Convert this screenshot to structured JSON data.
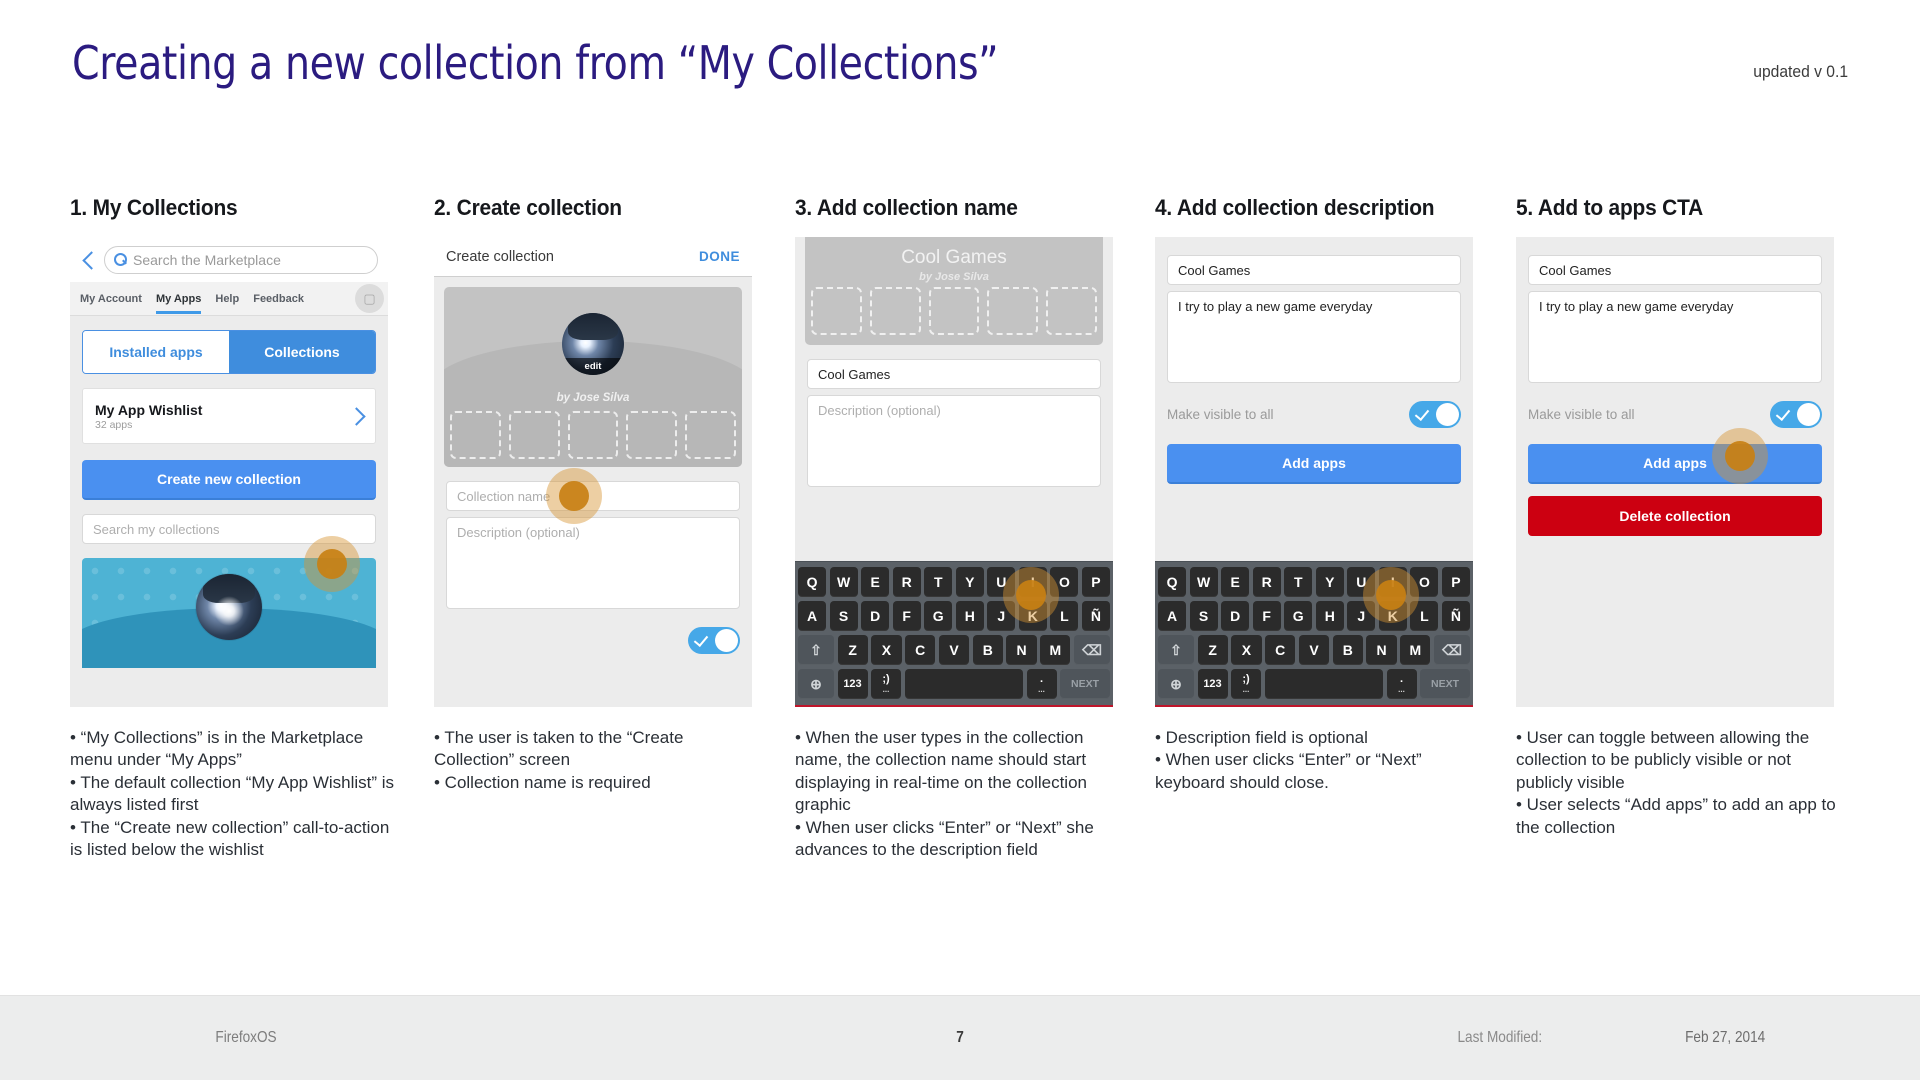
{
  "header": {
    "title": "Creating a new collection from “My Collections”",
    "version": "updated v 0.1"
  },
  "panels": [
    {
      "title": "1. My Collections",
      "search": {
        "placeholder": "Search the Marketplace"
      },
      "nav": [
        "My Account",
        "My Apps",
        "Help",
        "Feedback"
      ],
      "segmented": {
        "left": "Installed apps",
        "right": "Collections"
      },
      "wishlist": {
        "title": "My App Wishlist",
        "subtitle": "32 apps"
      },
      "cta": "Create new collection",
      "search_collections_placeholder": "Search my collections",
      "caption": [
        "• “My Collections” is in the Marketplace menu under “My Apps”",
        "• The default collection “My App Wishlist” is always listed first",
        "• The “Create new collection” call-to-action is listed below the wishlist"
      ]
    },
    {
      "title": "2. Create collection",
      "topbar": {
        "title": "Create collection",
        "action": "DONE"
      },
      "edit_badge": "edit",
      "byline": "by Jose Silva",
      "name_placeholder": "Collection name",
      "description_placeholder": "Description (optional)",
      "caption": [
        "• The user is taken to the “Create Collection” screen",
        "• Collection name is required"
      ]
    },
    {
      "title": "3. Add collection name",
      "cover_name": "Cool Games",
      "byline": "by Jose Silva",
      "name_value": "Cool Games",
      "description_placeholder": "Description (optional)",
      "caption": [
        "• When the user types in the collection name, the collection name should start displaying in real-time on the collection graphic",
        "• When user clicks “Enter” or “Next” she advances to the description field"
      ]
    },
    {
      "title": "4. Add collection description",
      "name_value": "Cool Games",
      "description_value": "I try to play a new game everyday",
      "toggle_label": "Make visible to all",
      "add_apps": "Add apps",
      "caption": [
        "• Description field is optional",
        "• When user clicks “Enter” or “Next” keyboard should close."
      ]
    },
    {
      "title": "5. Add to apps CTA",
      "name_value": "Cool Games",
      "description_value": "I try to play a new game everyday",
      "toggle_label": "Make visible to all",
      "add_apps": "Add apps",
      "delete_collection": "Delete collection",
      "caption": [
        "• User can toggle between allowing the collection to be publicly visible or not publicly visible",
        "• User selects “Add apps” to add an app to the collection"
      ]
    }
  ],
  "keyboard": {
    "row1": [
      "Q",
      "W",
      "E",
      "R",
      "T",
      "Y",
      "U",
      "I",
      "O",
      "P"
    ],
    "row2": [
      "A",
      "S",
      "D",
      "F",
      "G",
      "H",
      "J",
      "K",
      "L",
      "Ñ"
    ],
    "row3": [
      "Z",
      "X",
      "C",
      "V",
      "B",
      "N",
      "M"
    ],
    "shift": "⇧",
    "backspace": "⌫",
    "globe": "⊕",
    "numbers": "123",
    "symbols": ";)",
    "symbols_sub": "...",
    "period": ".",
    "period_sub": "...",
    "next": "NEXT"
  },
  "footer": {
    "left": "FirefoxOS",
    "page": "7",
    "modified_label": "Last Modified:",
    "modified_date": "Feb 27, 2014"
  },
  "colors": {
    "title": "#2b1b80",
    "accent_blue": "#4a90f0",
    "danger_red": "#cc0011",
    "toggle_on": "#46a8e8"
  }
}
